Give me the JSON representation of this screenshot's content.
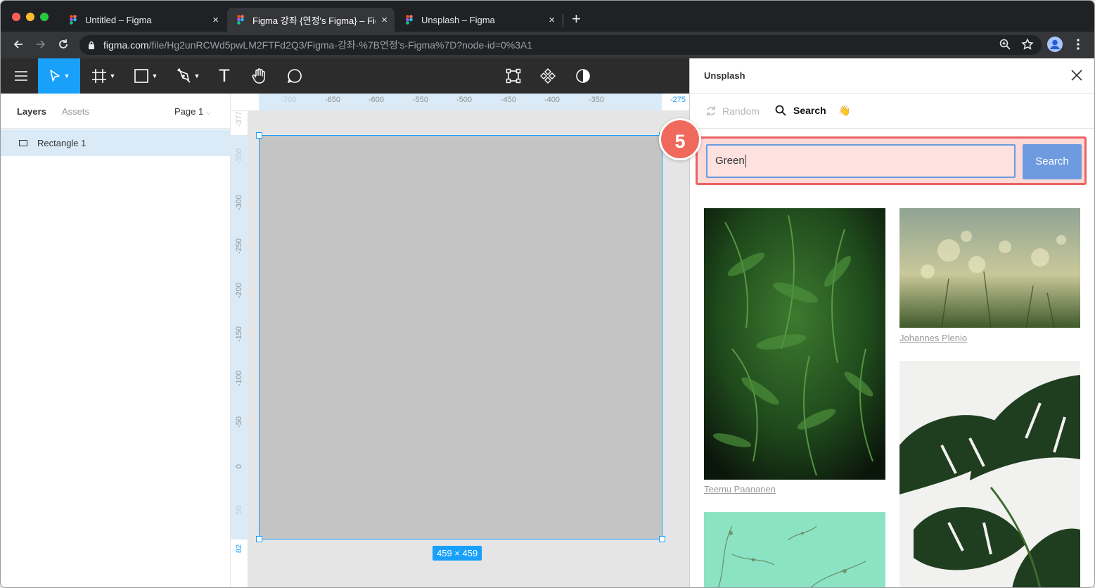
{
  "browser": {
    "tabs": [
      {
        "title": "Untitled – Figma",
        "active": false
      },
      {
        "title": "Figma 강좌 {연정's Figma} – Figm",
        "active": true
      },
      {
        "title": "Unsplash – Figma",
        "active": false
      }
    ],
    "new_tab_label": "+",
    "close_label": "×",
    "url": {
      "host": "figma.com",
      "path": "/file/Hg2unRCWd5pwLM2FTFd2Q3/Figma-강좌-%7B연정's-Figma%7D?node-id=0%3A1"
    }
  },
  "toolbar": {
    "icons": [
      "menu-icon",
      "move-tool-icon",
      "frame-tool-icon",
      "rectangle-tool-icon",
      "pen-tool-icon",
      "text-tool-icon",
      "hand-tool-icon",
      "comment-tool-icon",
      "component-icon",
      "boolean-icon",
      "mask-icon"
    ],
    "text_tool_label": "T"
  },
  "left_panel": {
    "tabs": [
      "Layers",
      "Assets"
    ],
    "page_selector": "Page 1",
    "layers": [
      {
        "name": "Rectangle 1",
        "selected": true
      }
    ]
  },
  "canvas": {
    "ruler_h": [
      "-700",
      "-650",
      "-600",
      "-550",
      "-500",
      "-450",
      "-400",
      "-350",
      "-275"
    ],
    "ruler_v": [
      "-377",
      "-350",
      "-300",
      "-250",
      "-200",
      "-150",
      "-100",
      "-50",
      "0",
      "50",
      "82"
    ],
    "selection_size": "459 × 459",
    "rect_fill": "#c4c4c4",
    "selection_color": "#18a0fb"
  },
  "plugin": {
    "title": "Unsplash",
    "tabs": {
      "random": "Random",
      "search": "Search",
      "wave": "👋"
    },
    "search_value": "Green",
    "search_button": "Search",
    "results": [
      {
        "credit": "Teemu Paananen",
        "subject": "fern"
      },
      {
        "credit": "Johannes Plenio",
        "subject": "bokeh-grass"
      },
      {
        "credit": "",
        "subject": "monstera"
      },
      {
        "credit": "",
        "subject": "mint-wall-plant"
      }
    ]
  },
  "annotation": {
    "step_number": "5",
    "highlight_color": "#eb6262"
  }
}
